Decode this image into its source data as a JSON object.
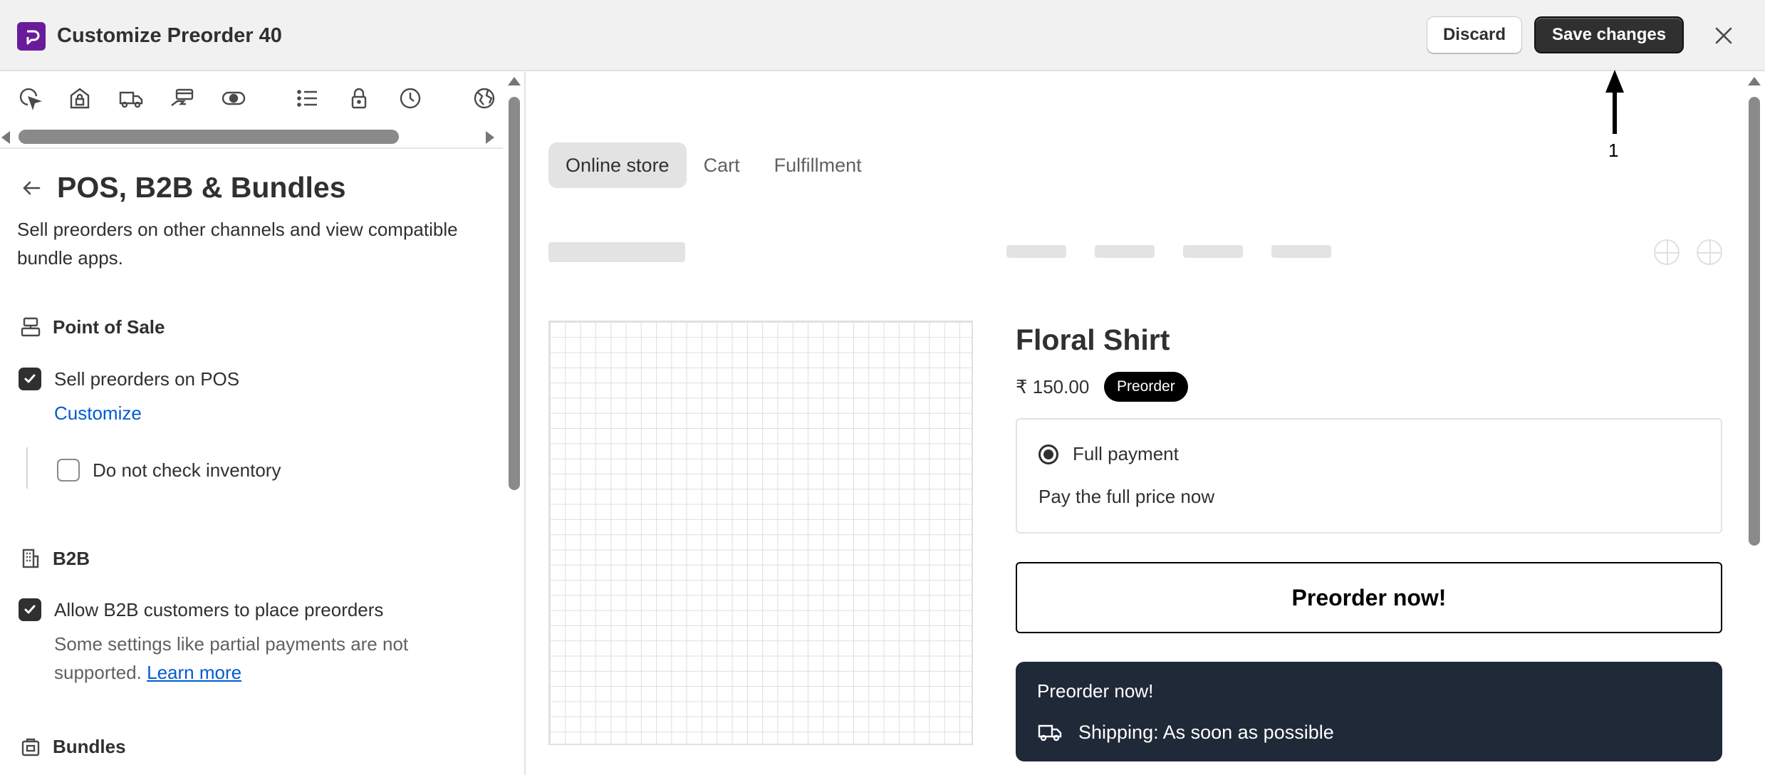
{
  "header": {
    "title": "Customize Preorder 40",
    "discard_label": "Discard",
    "save_label": "Save changes"
  },
  "sidebar": {
    "icon_strip": [
      "cursor-click-icon",
      "store-lock-icon",
      "delivery-truck-icon",
      "hand-card-icon",
      "eye-toggle-icon",
      "list-icon",
      "lock-icon",
      "clock-icon",
      "globe-icon"
    ],
    "section_title": "POS, B2B & Bundles",
    "section_description": "Sell preorders on other channels and view compatible bundle apps.",
    "pos": {
      "title": "Point of Sale",
      "sell_label": "Sell preorders on POS",
      "sell_checked": true,
      "customize_link": "Customize",
      "inventory_label": "Do not check inventory",
      "inventory_checked": false
    },
    "b2b": {
      "title": "B2B",
      "allow_label": "Allow B2B customers to place preorders",
      "allow_checked": true,
      "help_text": "Some settings like partial payments are not supported.",
      "learn_more": "Learn more"
    },
    "bundles": {
      "title": "Bundles"
    }
  },
  "preview": {
    "tabs": [
      {
        "label": "Online store",
        "active": true
      },
      {
        "label": "Cart",
        "active": false
      },
      {
        "label": "Fulfillment",
        "active": false
      }
    ],
    "product": {
      "title": "Floral Shirt",
      "price": "₹ 150.00",
      "badge": "Preorder",
      "payment_option": "Full payment",
      "payment_description": "Pay the full price now",
      "button_outline": "Preorder now!",
      "button_dark_title": "Preorder now!",
      "shipping_text": "Shipping: As soon as possible"
    }
  },
  "annotation": {
    "label": "1"
  },
  "colors": {
    "app_brand": "#6a1b9a",
    "primary_button": "#303030",
    "link": "#005bd3",
    "dark_button": "#1f2937"
  }
}
